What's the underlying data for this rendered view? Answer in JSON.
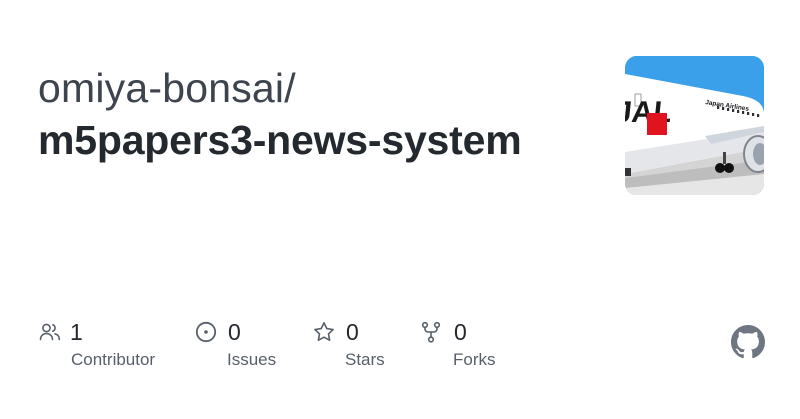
{
  "repo": {
    "owner": "omiya-bonsai/",
    "name": "m5papers3-news-system"
  },
  "thumbnail": {
    "airline_text": "Japan Airlines",
    "logo_text": "JAL",
    "colors": {
      "sky": "#3aa0ea",
      "fuselage": "#ffffff",
      "accent": "#e0141e",
      "ground": "#c9c9c9"
    }
  },
  "stats": [
    {
      "icon": "people-icon",
      "value": "1",
      "label": "Contributor"
    },
    {
      "icon": "issue-icon",
      "value": "0",
      "label": "Issues"
    },
    {
      "icon": "star-icon",
      "value": "0",
      "label": "Stars"
    },
    {
      "icon": "fork-icon",
      "value": "0",
      "label": "Forks"
    }
  ],
  "brand": {
    "logo": "github-mark-icon",
    "color": "#6e7781"
  }
}
